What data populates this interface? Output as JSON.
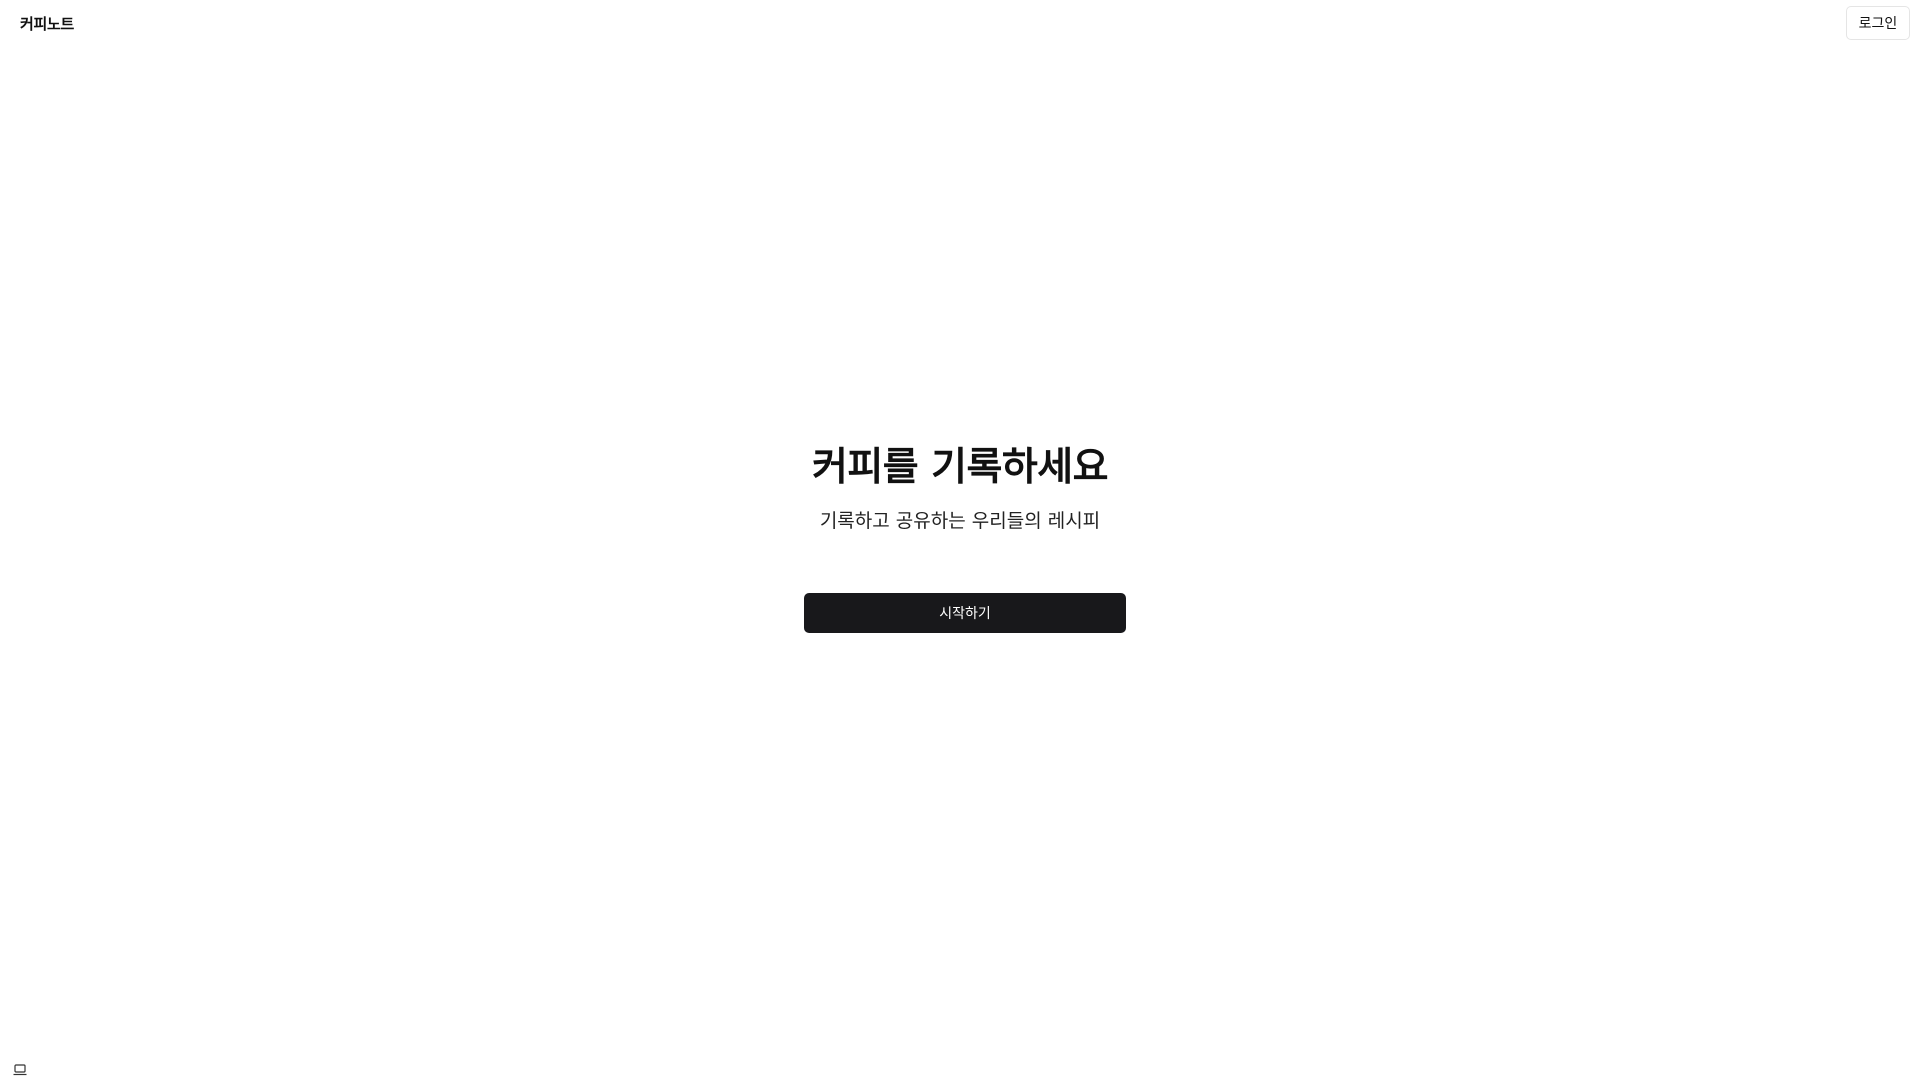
{
  "header": {
    "brand": "커피노트",
    "login_label": "로그인"
  },
  "hero": {
    "title": "커피를 기록하세요",
    "subtitle": "기록하고 공유하는 우리들의 레시피",
    "start_label": "시작하기"
  },
  "icons": {
    "corner": "laptop-icon"
  },
  "colors": {
    "background": "#ffffff",
    "text": "#111111",
    "primary_button": "#18181b",
    "primary_button_text": "#ffffff",
    "border": "#e5e5e5"
  }
}
